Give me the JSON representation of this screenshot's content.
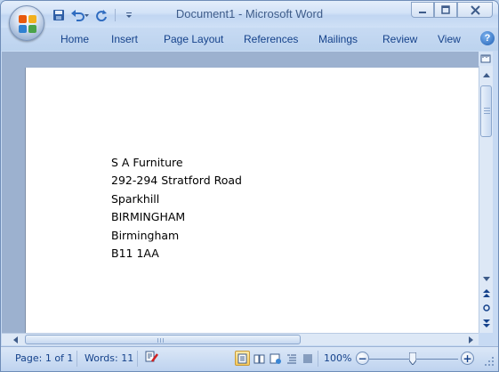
{
  "window": {
    "title": "Document1 - Microsoft Word"
  },
  "quick_access": {
    "save_icon": "save-icon",
    "undo_icon": "undo-icon",
    "redo_icon": "redo-icon",
    "customize_icon": "customize-qat-icon"
  },
  "ribbon": {
    "tabs": [
      {
        "label": "Home"
      },
      {
        "label": "Insert"
      },
      {
        "label": "Page Layout"
      },
      {
        "label": "References"
      },
      {
        "label": "Mailings"
      },
      {
        "label": "Review"
      },
      {
        "label": "View"
      }
    ],
    "help_label": "?"
  },
  "document": {
    "lines": [
      "S A Furniture",
      "292-294 Stratford Road",
      "Sparkhill",
      "BIRMINGHAM",
      "Birmingham",
      "B11 1AA"
    ]
  },
  "status": {
    "page": "Page: 1 of 1",
    "words": "Words: 11",
    "zoom": "100%",
    "zoom_out": "−",
    "zoom_in": "+",
    "zoom_level": 1.0
  },
  "colors": {
    "chrome": "#c7daf3",
    "text": "#15428b",
    "page": "#ffffff",
    "workspace": "#9cb1cf"
  }
}
